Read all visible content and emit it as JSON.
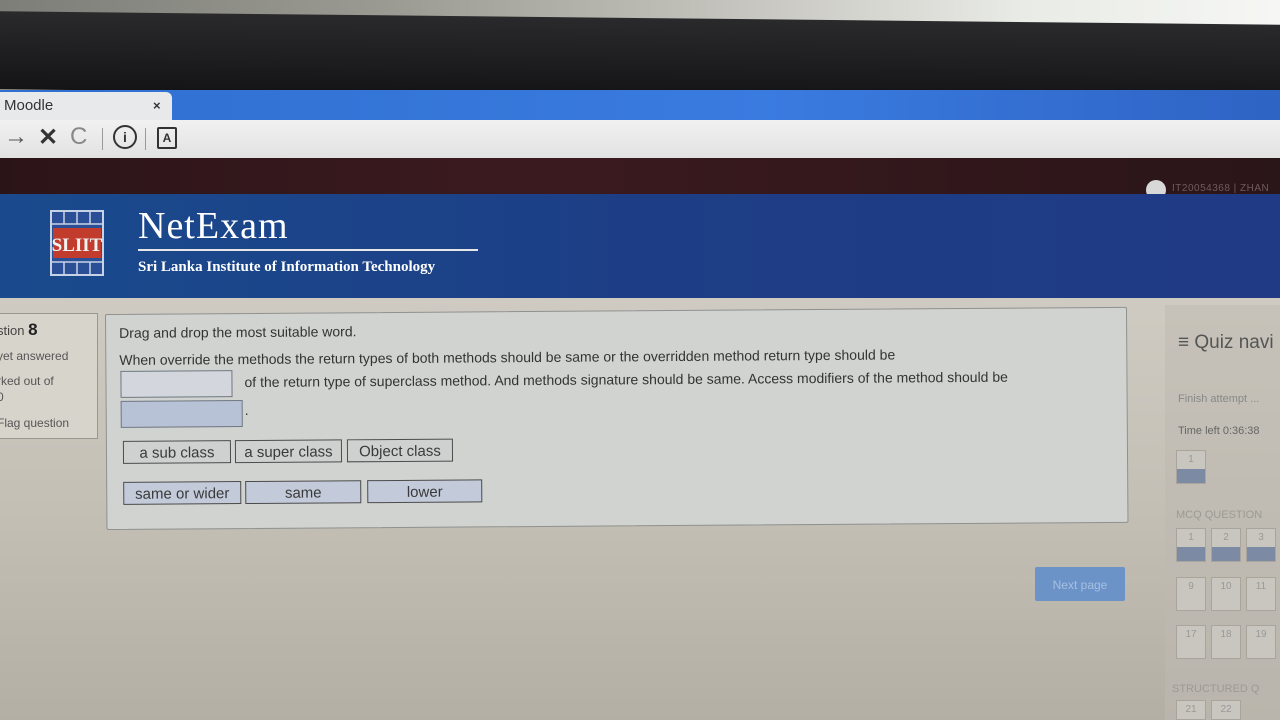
{
  "browser": {
    "tab_title": "Moodle",
    "tab_close": "×"
  },
  "site": {
    "title": "NetExam",
    "subtitle": "Sri Lanka Institute of Information Technology",
    "logo_text": "SLIIT",
    "user_text": "IT20054368 | ZHAN"
  },
  "question_info": {
    "number_prefix": "stion",
    "number": "8",
    "state": "yet answered",
    "marked": "rked out of",
    "marked_value": "0",
    "flag": "Flag question"
  },
  "question": {
    "instruction": "Drag and drop the most suitable word.",
    "line1": "When override the methods the return types of both methods should be same or the overridden method return type should be",
    "line2": "of the return type of superclass method. And methods signature should be same. Access modifiers of the method should be",
    "end_dot": ".",
    "drag_items": [
      "a sub class",
      "a super class",
      "Object class",
      "same or wider",
      "same",
      "lower"
    ]
  },
  "next_button": "Next page",
  "quiz_nav": {
    "title": "≡ Quiz navi",
    "finish": "Finish attempt ...",
    "time_left": "Time left 0:36:38",
    "section1": "MCQ QUESTION",
    "section2": "STRUCTURED Q",
    "top_button": "1",
    "mcq_buttons": [
      "1",
      "2",
      "3",
      "9",
      "10",
      "11",
      "17",
      "18",
      "19"
    ],
    "struct_buttons": [
      "21",
      "22"
    ]
  },
  "colors": {
    "banner": "#1d3e86",
    "tabstrip": "#3a7be0",
    "answered": "#7d8aa3",
    "next_button": "#6c93c8"
  }
}
